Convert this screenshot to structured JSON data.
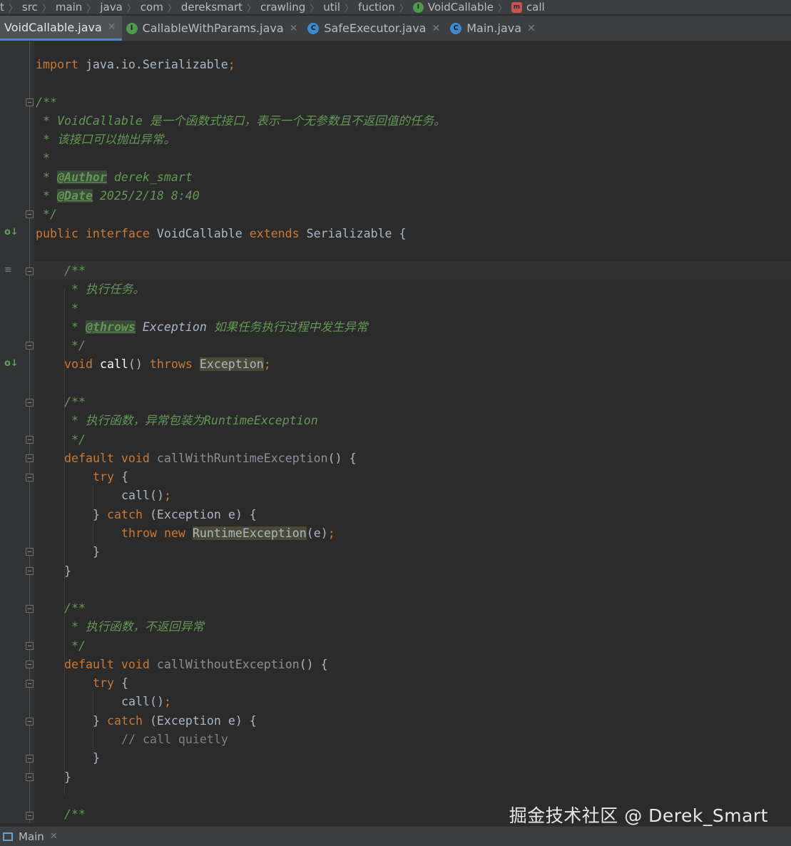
{
  "breadcrumb": {
    "items": [
      "t",
      "src",
      "main",
      "java",
      "com",
      "dereksmart",
      "crawling",
      "util",
      "fuction",
      "VoidCallable",
      "call"
    ]
  },
  "tabs": [
    {
      "label": "VoidCallable.java",
      "icon": "interface-icon",
      "active": true
    },
    {
      "label": "CallableWithParams.java",
      "icon": "interface-icon",
      "active": false
    },
    {
      "label": "SafeExecutor.java",
      "icon": "class-icon",
      "active": false
    },
    {
      "label": "Main.java",
      "icon": "class-icon",
      "active": false
    }
  ],
  "code": {
    "import_kw": "import",
    "import_path": " java.io.Serializable",
    "semi": ";",
    "doc_open": "/**",
    "doc1_line1": " * VoidCallable 是一个函数式接口，表示一个无参数且不返回值的任务。",
    "doc1_line2": " * 该接口可以抛出异常。",
    "doc_star": " *",
    "author_prefix": " * ",
    "author_tag": "@Author",
    "author_val": " derek_smart",
    "date_prefix": " * ",
    "date_tag": "@Date",
    "date_val": " 2025/2/18 8:40",
    "doc_close": " */",
    "iface_public": "public",
    "iface_interface": " interface",
    "iface_name": " VoidCallable",
    "iface_extends": " extends",
    "iface_super": " Serializable {",
    "m1_doc_open": "/**",
    "m1_doc_line1": " * 执行任务。",
    "m1_doc_star": " *",
    "m1_throws_prefix": " * ",
    "m1_throws_tag": "@throws",
    "m1_throws_type": " Exception",
    "m1_throws_desc": " 如果任务执行过程中发生异常",
    "m1_doc_close": " */",
    "m1_void": "void",
    "m1_name": " call",
    "m1_parens": "()",
    "m1_throws": " throws",
    "m1_exc": "Exception",
    "m1_semi": ";",
    "m2_doc_open": "/**",
    "m2_doc_line1": " * 执行函数，异常包装为RuntimeException",
    "m2_doc_close": " */",
    "m2_default": "default",
    "m2_void": " void",
    "m2_name": " callWithRuntimeException",
    "m2_rest": "() {",
    "m2_try": "try",
    "m2_try_brace": " {",
    "m2_call": "call()",
    "m2_call_semi": ";",
    "m2_close_brace": "}",
    "m2_catch": " catch",
    "m2_catch_args": " (Exception e) {",
    "m2_throw": "throw",
    "m2_new": " new",
    "m2_rte": "RuntimeException",
    "m2_rte_args": "(e)",
    "m2_rte_semi": ";",
    "m2_inner_close": "}",
    "m2_outer_close": "}",
    "m3_doc_open": "/**",
    "m3_doc_line1": " * 执行函数，不返回异常",
    "m3_doc_close": " */",
    "m3_default": "default",
    "m3_void": " void",
    "m3_name": " callWithoutException",
    "m3_rest": "() {",
    "m3_try": "try",
    "m3_try_brace": " {",
    "m3_call": "call()",
    "m3_call_semi": ";",
    "m3_close_brace": "}",
    "m3_catch": " catch",
    "m3_catch_args": " (Exception e) {",
    "m3_comment": "// call quietly",
    "m3_inner_close": "}",
    "m3_outer_close": "}",
    "m4_doc_open": "/**"
  },
  "bottom": {
    "run_tab_label": "Main"
  },
  "watermark": "掘金技术社区 @ Derek_Smart",
  "colors": {
    "keyword": "#cc7832",
    "identifier": "#a9b7c6",
    "comment": "#629755",
    "method_decl": "#ffc66d",
    "background": "#2b2b2b",
    "gutter": "#313335"
  }
}
